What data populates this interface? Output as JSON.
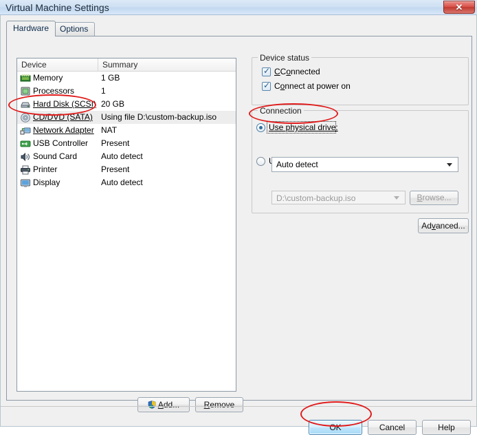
{
  "window": {
    "title": "Virtual Machine Settings",
    "close_label": "✕"
  },
  "tabs": [
    {
      "label": "Hardware",
      "active": true
    },
    {
      "label": "Options",
      "active": false
    }
  ],
  "device_table": {
    "columns": [
      "Device",
      "Summary"
    ],
    "rows": [
      {
        "icon": "memory-icon",
        "name": "Memory",
        "summary": "1 GB",
        "selected": false
      },
      {
        "icon": "processor-icon",
        "name": "Processors",
        "summary": "1",
        "selected": false
      },
      {
        "icon": "hard-disk-icon",
        "name": "Hard Disk (SCSI)",
        "summary": "20 GB",
        "selected": false
      },
      {
        "icon": "cd-dvd-icon",
        "name": "CD/DVD (SATA)",
        "summary": "Using file D:\\custom-backup.iso",
        "selected": true
      },
      {
        "icon": "network-adapter-icon",
        "name": "Network Adapter",
        "summary": "NAT",
        "selected": false
      },
      {
        "icon": "usb-controller-icon",
        "name": "USB Controller",
        "summary": "Present",
        "selected": false
      },
      {
        "icon": "sound-card-icon",
        "name": "Sound Card",
        "summary": "Auto detect",
        "selected": false
      },
      {
        "icon": "printer-icon",
        "name": "Printer",
        "summary": "Present",
        "selected": false
      },
      {
        "icon": "display-icon",
        "name": "Display",
        "summary": "Auto detect",
        "selected": false
      }
    ]
  },
  "list_buttons": {
    "add": "Add...",
    "remove": "Remove"
  },
  "device_status": {
    "title": "Device status",
    "connected": {
      "label": "Connected",
      "checked": true
    },
    "connect_at_power_on": {
      "label": "Connect at power on",
      "checked": true
    }
  },
  "connection": {
    "title": "Connection",
    "use_physical_drive": {
      "label": "Use physical drive:",
      "checked": true
    },
    "physical_drive_value": "Auto detect",
    "use_iso_image": {
      "label": "Use ISO image file:",
      "checked": false
    },
    "iso_path_value": "D:\\custom-backup.iso",
    "browse_label": "Browse...",
    "advanced_label": "Advanced..."
  },
  "dialog_buttons": {
    "ok": "OK",
    "cancel": "Cancel",
    "help": "Help"
  },
  "annotations": {
    "color": "#e01b1b",
    "highlights": [
      "cd-dvd-row",
      "use-physical-drive-radio",
      "ok-button"
    ]
  }
}
